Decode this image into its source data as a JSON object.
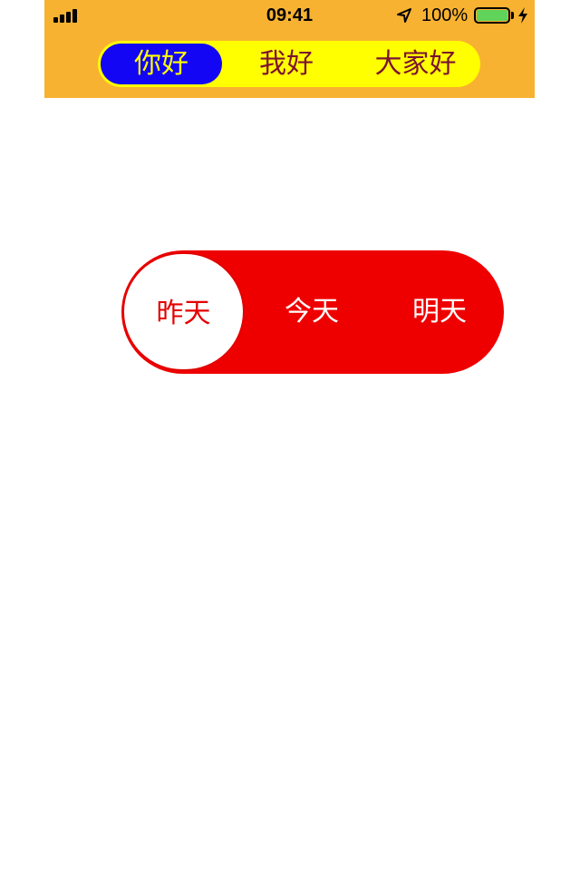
{
  "status_bar": {
    "time": "09:41",
    "battery_percent": "100%",
    "battery_level": 1.0,
    "icons": [
      "signal-icon",
      "location-arrow-icon",
      "battery-icon",
      "charging-bolt-icon"
    ]
  },
  "top_segmented": {
    "items": [
      "你好",
      "我好",
      "大家好"
    ],
    "selected_index": 0,
    "colors": {
      "bar": "#f7b231",
      "track": "#ffff00",
      "selected_bg": "#1206f5",
      "selected_text": "#ffff00",
      "text": "#7b1430"
    }
  },
  "day_segmented": {
    "items": [
      "昨天",
      "今天",
      "明天"
    ],
    "selected_index": 0,
    "colors": {
      "track": "#ef0000",
      "selected_bg": "#ffffff",
      "selected_text": "#e30000",
      "text": "#ffffff"
    }
  }
}
